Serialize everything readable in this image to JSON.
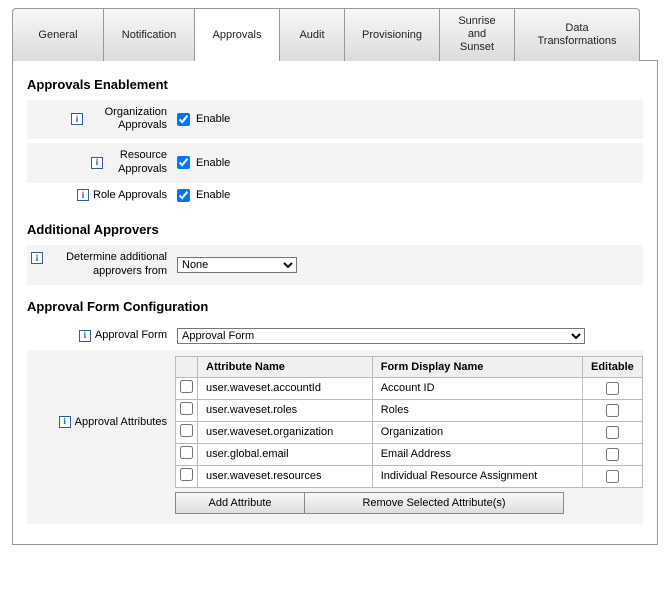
{
  "tabs": {
    "general": "General",
    "notification": "Notification",
    "approvals": "Approvals",
    "audit": "Audit",
    "provisioning": "Provisioning",
    "sunrise": "Sunrise\nand\nSunset",
    "data_transformations": "Data\nTransformations"
  },
  "sections": {
    "enablement": "Approvals Enablement",
    "additional": "Additional Approvers",
    "form_config": "Approval Form Configuration"
  },
  "enablement": {
    "org_label": "Organization Approvals",
    "res_label": "Resource Approvals",
    "role_label": "Role Approvals",
    "enable_text": "Enable"
  },
  "additional": {
    "label": "Determine additional approvers from",
    "value": "None"
  },
  "form": {
    "label": "Approval Form",
    "value": "Approval Form"
  },
  "attrs": {
    "label": "Approval Attributes",
    "headers": {
      "name": "Attribute Name",
      "display": "Form Display Name",
      "editable": "Editable"
    },
    "rows": [
      {
        "name": "user.waveset.accountId",
        "display": "Account ID"
      },
      {
        "name": "user.waveset.roles",
        "display": "Roles"
      },
      {
        "name": "user.waveset.organization",
        "display": "Organization"
      },
      {
        "name": "user.global.email",
        "display": "Email Address"
      },
      {
        "name": "user.waveset.resources",
        "display": "Individual Resource Assignment"
      }
    ]
  },
  "buttons": {
    "add": "Add Attribute",
    "remove": "Remove Selected Attribute(s)"
  }
}
